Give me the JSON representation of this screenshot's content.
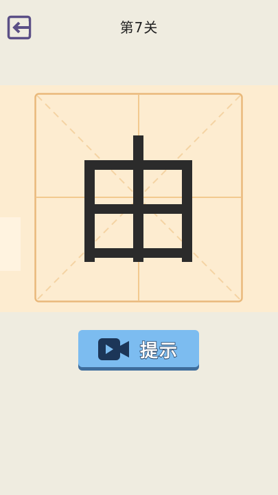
{
  "header": {
    "back_icon": "exit-arrow-icon",
    "level_title": "第7关"
  },
  "board": {
    "character": "由",
    "grid_style": "mi-zi-ge"
  },
  "hint": {
    "label": "提示",
    "icon": "video-camera-icon"
  },
  "colors": {
    "background": "#efece0",
    "board_band": "#fdecd0",
    "grid_line": "#f2c98e",
    "glyph": "#2b2b2b",
    "button": "#7cbcf0",
    "icon_purple": "#5b4f86"
  }
}
